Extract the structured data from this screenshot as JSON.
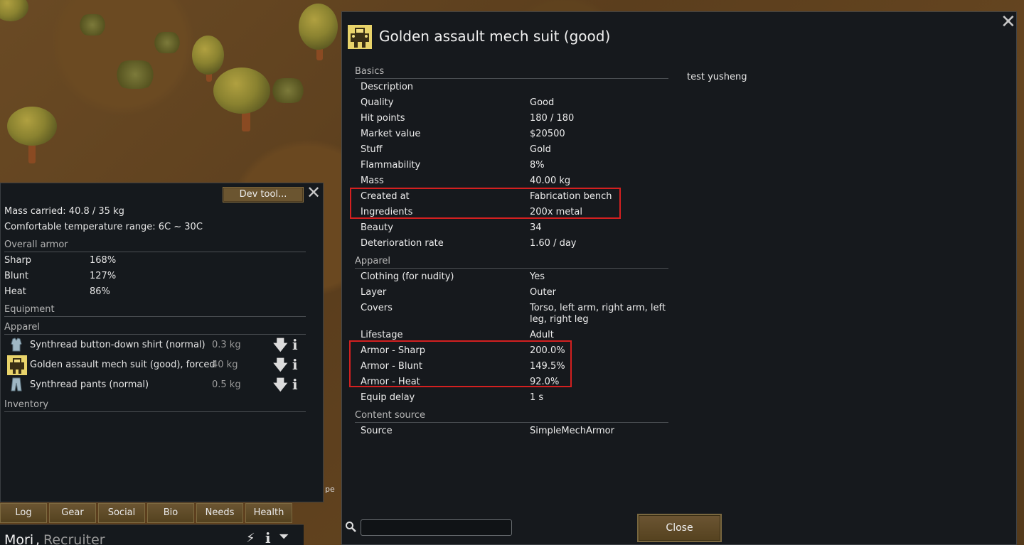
{
  "colors": {
    "panel_bg": "#15191d",
    "button_brown": "#6b5530",
    "highlight_red": "#d42020"
  },
  "gear_panel": {
    "dev_tool_label": "Dev tool...",
    "mass_carried": "Mass carried: 40.8 / 35 kg",
    "comfortable_temperature": "Comfortable temperature range: 6C ~ 30C",
    "overall_armor_header": "Overall armor",
    "armor": [
      {
        "label": "Sharp",
        "value": "168%"
      },
      {
        "label": "Blunt",
        "value": "127%"
      },
      {
        "label": "Heat",
        "value": "86%"
      }
    ],
    "equipment_header": "Equipment",
    "apparel_header": "Apparel",
    "apparel": [
      {
        "icon": "shirt-icon",
        "name": "Synthread button-down shirt (normal)",
        "mass": "0.3 kg"
      },
      {
        "icon": "mech-suit-icon",
        "name": "Golden assault mech suit (good), forced",
        "mass": "40 kg"
      },
      {
        "icon": "pants-icon",
        "name": "Synthread pants (normal)",
        "mass": "0.5 kg"
      }
    ],
    "inventory_header": "Inventory"
  },
  "map_fragment_text": "pe",
  "tabs": [
    "Log",
    "Gear",
    "Social",
    "Bio",
    "Needs",
    "Health"
  ],
  "pawn": {
    "name": "Mori",
    "separator": ",",
    "role": "Recruiter"
  },
  "dialog": {
    "title": "Golden assault mech suit (good)",
    "description_text": "test yusheng",
    "sections": {
      "basics": "Basics",
      "apparel": "Apparel",
      "content_source": "Content source"
    },
    "basics_rows": [
      {
        "label": "Description",
        "value": ""
      },
      {
        "label": "Quality",
        "value": "Good"
      },
      {
        "label": "Hit points",
        "value": "180 / 180"
      },
      {
        "label": "Market value",
        "value": "$20500"
      },
      {
        "label": "Stuff",
        "value": "Gold"
      },
      {
        "label": "Flammability",
        "value": "8%"
      },
      {
        "label": "Mass",
        "value": "40.00 kg"
      },
      {
        "label": "Created at",
        "value": "Fabrication bench"
      },
      {
        "label": "Ingredients",
        "value": "200x metal"
      },
      {
        "label": "Beauty",
        "value": "34"
      },
      {
        "label": "Deterioration rate",
        "value": "1.60 / day"
      }
    ],
    "apparel_rows": [
      {
        "label": "Clothing (for nudity)",
        "value": "Yes"
      },
      {
        "label": "Layer",
        "value": "Outer"
      },
      {
        "label": "Covers",
        "value": "Torso, left arm, right arm, left leg, right leg"
      },
      {
        "label": "Lifestage",
        "value": "Adult"
      },
      {
        "label": "Armor - Sharp",
        "value": "200.0%"
      },
      {
        "label": "Armor - Blunt",
        "value": "149.5%"
      },
      {
        "label": "Armor - Heat",
        "value": "92.0%"
      },
      {
        "label": "Equip delay",
        "value": "1 s"
      }
    ],
    "source_rows": [
      {
        "label": "Source",
        "value": "SimpleMechArmor"
      }
    ],
    "search_value": "",
    "close_label": "Close"
  }
}
